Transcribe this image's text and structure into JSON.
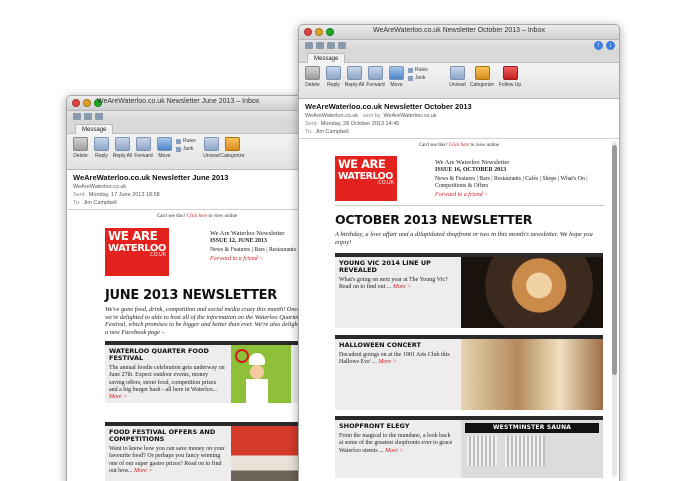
{
  "toolbar": {
    "tab": "Message",
    "delete": "Delete",
    "reply": "Reply",
    "reply_all": "Reply All",
    "forward": "Forward",
    "move": "Move",
    "rules": "Rules",
    "junk": "Junk",
    "unread": "Unread",
    "categorize": "Categorize",
    "follow_up": "Follow Up"
  },
  "back_window": {
    "title": "WeAreWaterloo.co.uk Newsletter June 2013 – Inbox",
    "subject": "WeAreWaterloo.co.uk Newsletter June 2013",
    "from": "WeAreWaterloo.co.uk",
    "sent_label": "Sent:",
    "sent": "Monday, 17 June 2013 18:58",
    "to_label": "To:",
    "to": "Jim Campbell",
    "cant_see_prefix": "Can't see this?",
    "click_here": "Click here",
    "cant_see_suffix": "to view online",
    "logo_line1": "WE",
    "logo_line2": "ARE",
    "logo_line3": "WATERLOO",
    "logo_small": ".CO.UK",
    "nl_name": "We Are Waterloo Newsletter",
    "issue": "ISSUE 12, JUNE 2013",
    "sections": "News & Features | Bars | Restaurants | Cafés | Shops | What's On | Competitions & Offers",
    "forward_friend": "Forward to a friend >",
    "heading": "JUNE 2013 NEWSLETTER",
    "intro": "We've gone food, drink, competition and social media crazy this month! Once again we're delighted to able to host all of the information on the Waterloo Quarter Food Festival, which promises to be bigger and better than ever. We're also delighted to have a new Facebook page –",
    "cards": [
      {
        "title": "WATERLOO QUARTER FOOD FESTIVAL",
        "desc": "The annual foodie celebration gets underway on June 27th. Expect outdoor events, money saving offers, street food, competition prizes and a big burger bash - all here in Waterloo...",
        "more": "More >"
      },
      {
        "title": "FOOD FESTIVAL OFFERS AND COMPETITIONS",
        "desc": "Want to know how you can save money on your favourite food? Or perhaps you fancy winning one of our super gastro prizes? Read on to find out how...",
        "more": "More >"
      }
    ]
  },
  "front_window": {
    "title": "WeAreWaterloo.co.uk Newsletter October 2013 – Inbox",
    "subject": "WeAreWaterloo.co.uk Newsletter October 2013",
    "from": "WeAreWaterloo.co.uk",
    "sent_by_label": "sent by",
    "sent_by": "WeAreWaterloo.co.uk",
    "sent_label": "Sent:",
    "sent": "Monday, 28 October 2013 14:45",
    "to_label": "To:",
    "to": "Jim Campbell",
    "cant_see_prefix": "Can't see this?",
    "click_here": "Click here",
    "cant_see_suffix": "to view online",
    "logo_line1": "WE",
    "logo_line2": "ARE",
    "logo_line3": "WATERLOO",
    "logo_small": ".CO.UK",
    "nl_name": "We Are Waterloo Newsletter",
    "issue": "ISSUE 16, OCTOBER 2013",
    "sections": "News & Features | Bars | Restaurants | Cafés | Shops | What's On | Competitions & Offers",
    "forward_friend": "Forward to a friend >",
    "heading": "OCTOBER 2013 NEWSLETTER",
    "intro": "A birthday, a love affair and a dilapidated shopfront or two in this month's newsletter. We hope you enjoy!",
    "cards": [
      {
        "title": "YOUNG VIC 2014 LINE UP REVEALED",
        "desc": "What's going on next year at The Young Vic? Read on to find out ...",
        "more": "More >"
      },
      {
        "title": "HALLOWEEN CONCERT",
        "desc": "Decadent goings on at the 1901 Arts Club this Hallows Eve' ...",
        "more": "More >"
      },
      {
        "title": "SHOPFRONT ELEGY",
        "desc": "From the magical to the mundane, a look back at some of the greatest shopfronts ever to grace Waterloo streets ...",
        "more": "More >",
        "sign": "WESTMINSTER SAUNA"
      }
    ]
  },
  "colors": {
    "brand_red": "#e3211d",
    "link_red": "#d3191e",
    "card_bar": "#2a2a2a"
  }
}
